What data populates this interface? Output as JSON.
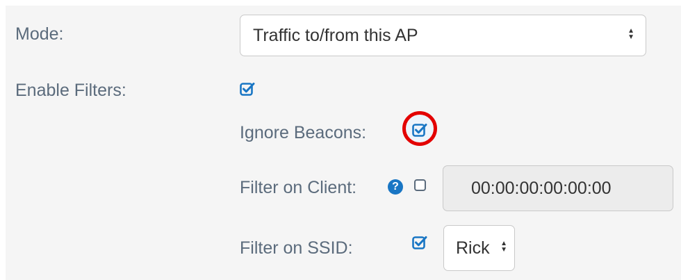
{
  "colors": {
    "accent": "#1976c4",
    "highlight_ring": "#e30000",
    "label": "#5b6b7c"
  },
  "mode": {
    "label": "Mode:",
    "value": "Traffic to/from this AP",
    "icon": "sort-arrows-icon"
  },
  "enable_filters": {
    "label": "Enable Filters:",
    "checked": true
  },
  "ignore_beacons": {
    "label": "Ignore Beacons:",
    "checked": true
  },
  "filter_client": {
    "label": "Filter on Client:",
    "help_icon": "question-circle-icon",
    "help_glyph": "?",
    "checked": false,
    "value": "00:00:00:00:00:00"
  },
  "filter_ssid": {
    "label": "Filter on SSID:",
    "checked": true,
    "value": "Rick"
  }
}
